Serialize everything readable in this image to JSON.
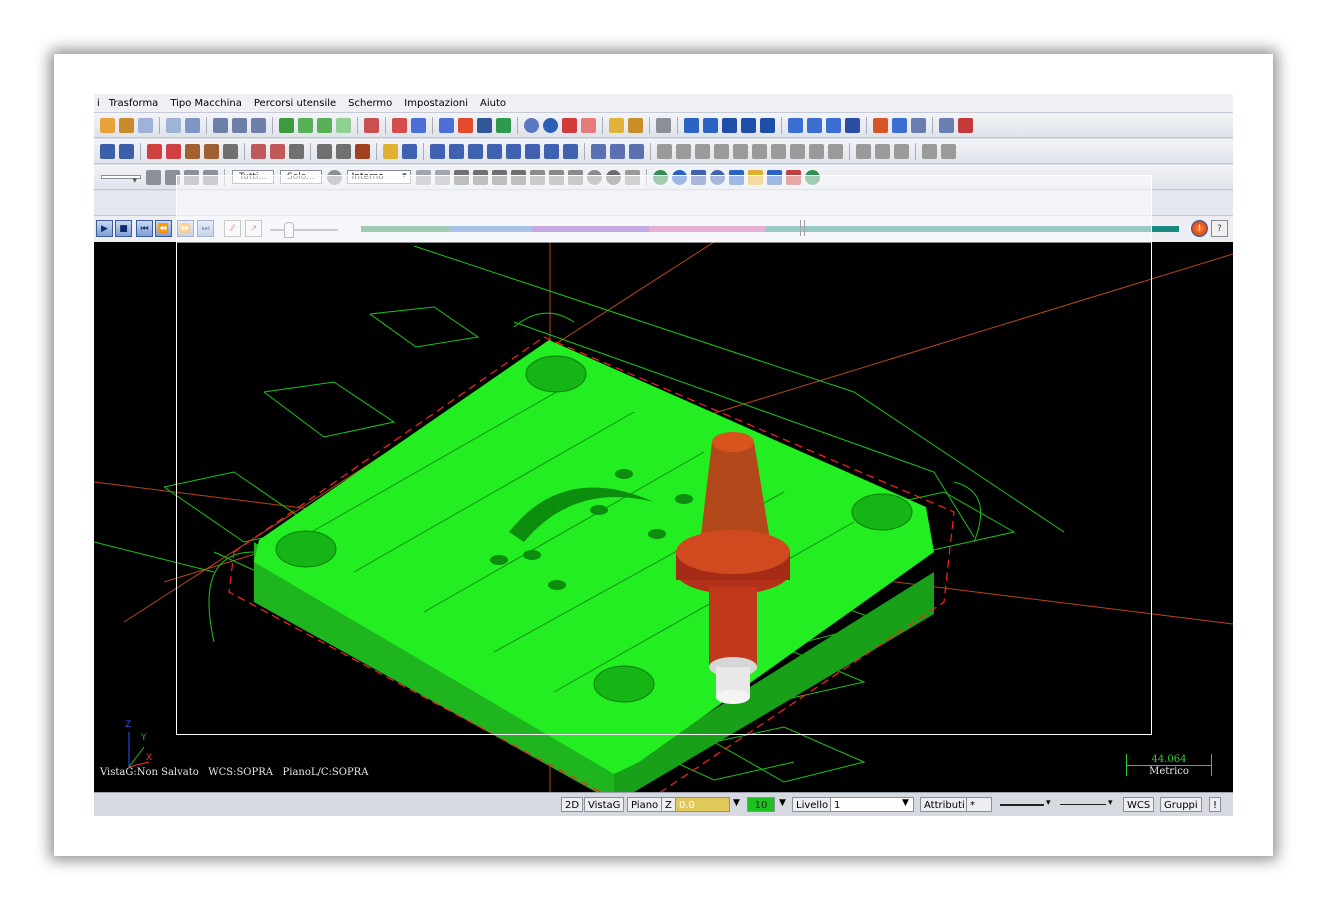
{
  "menu": [
    "Trasforma",
    "Tipo Macchina",
    "Percorsi utensile",
    "Schermo",
    "Impostazioni",
    "Aiuto"
  ],
  "toolbar3": {
    "btn_tutti": "Tutti...",
    "btn_solo": "Solo...",
    "select_interno": "Interno"
  },
  "viewport": {
    "status_line": "VistaG:Non Salvato   WCS:SOPRA   PianoL/C:SOPRA",
    "axis_z": "Z",
    "axis_y": "Y",
    "axis_x": "X",
    "scale_value": "44.064",
    "scale_unit": "Metrico"
  },
  "status": {
    "btn_2d": "2D",
    "btn_vistag": "VistaG",
    "btn_piano": "Piano",
    "z_label": "Z",
    "z_value": "0.0",
    "level_value": "10",
    "livello_label": "Livello",
    "livello_value": "1",
    "attributi": "Attributi",
    "star": "*",
    "wcs": "WCS",
    "gruppi": "Gruppi",
    "excl": "!"
  },
  "colors": {
    "part_green": "#22ee22",
    "wire_green": "#19c519",
    "tool_orange": "#c0391b",
    "viewport_bg": "#000000"
  }
}
